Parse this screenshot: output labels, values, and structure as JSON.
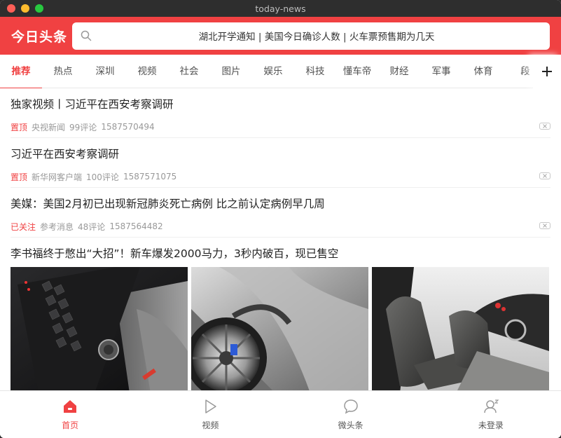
{
  "window": {
    "title": "today-news"
  },
  "header": {
    "logo": "今日头条",
    "search_text": "湖北开学通知 | 美国今日确诊人数 | 火车票预售期为几天"
  },
  "tabs": [
    "推荐",
    "热点",
    "深圳",
    "视频",
    "社会",
    "图片",
    "娱乐",
    "科技",
    "懂车帝",
    "财经",
    "军事",
    "体育",
    "段"
  ],
  "articles": [
    {
      "title": "独家视频丨习近平在西安考察调研",
      "tag": "置顶",
      "source": "央视新闻",
      "comments": "99评论",
      "time": "1587570494"
    },
    {
      "title": "习近平在西安考察调研",
      "tag": "置顶",
      "source": "新华网客户端",
      "comments": "100评论",
      "time": "1587571075"
    },
    {
      "title": "美媒：美国2月初已出现新冠肺炎死亡病例 比之前认定病例早几周",
      "tag": "已关注",
      "source": "参考消息",
      "comments": "48评论",
      "time": "1587564482"
    }
  ],
  "pic_article": {
    "title": "李书福终于憋出“大招”！新车爆发2000马力，3秒内破百，现已售空"
  },
  "bottom_nav": [
    "首页",
    "视频",
    "微头条",
    "未登录"
  ],
  "colors": {
    "brand": "#f04142",
    "title_bar": "#2e2e2e"
  }
}
